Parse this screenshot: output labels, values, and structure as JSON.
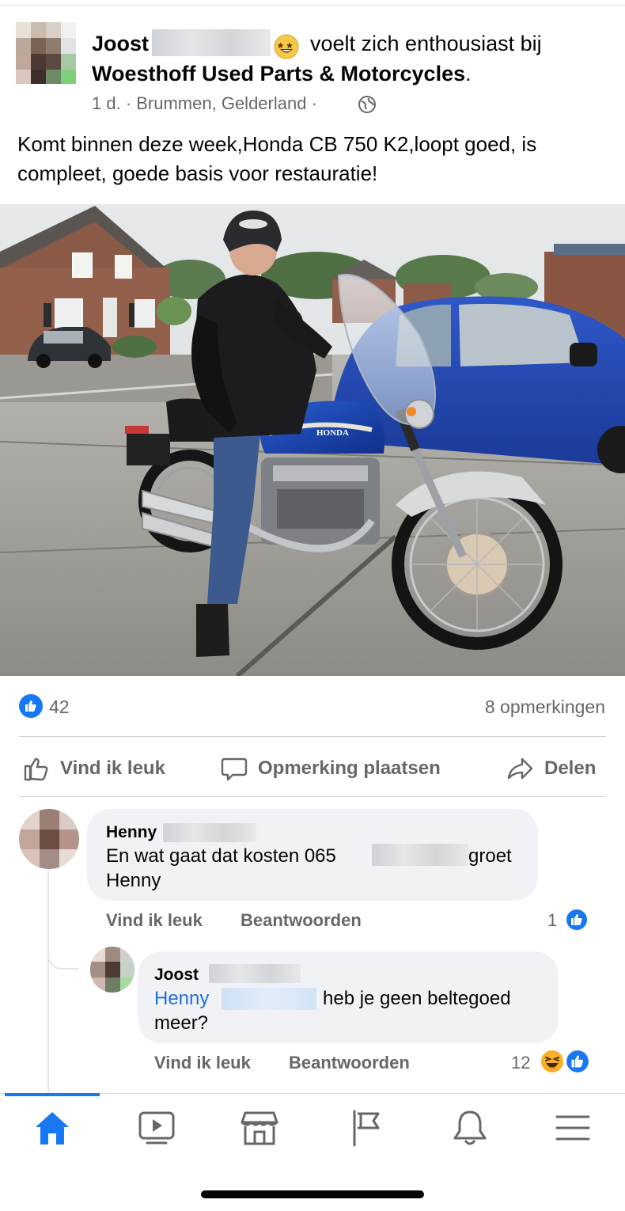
{
  "post": {
    "author": "Joost",
    "feeling": "voelt zich enthousiast bij",
    "page": "Woesthoff Used Parts & Motorcycles",
    "page_suffix": ".",
    "meta": "1 d. · Brummen, Gelderland ·",
    "text": "Komt binnen deze week,Honda CB 750 K2,loopt goed, is compleet, goede basis voor restauratie!",
    "feeling_icon": "grinning-star-eyes-emoji",
    "audience_icon": "globe-icon"
  },
  "photo": {
    "tank_brand": "HONDA"
  },
  "stats": {
    "likes": "42",
    "comments": "8 opmerkingen"
  },
  "actions": {
    "like": "Vind ik leuk",
    "comment": "Opmerking plaatsen",
    "share": "Delen"
  },
  "comments": [
    {
      "name": "Henny",
      "line1_a": "En wat gaat dat kosten 065",
      "line1_b": "groet",
      "line2": "Henny",
      "like": "Vind ik leuk",
      "reply": "Beantwoorden",
      "reactions": "1"
    },
    {
      "name": "Joost",
      "mention": "Henny",
      "line1_b": "heb je geen beltegoed",
      "line2": "meer?",
      "like": "Vind ik leuk",
      "reply": "Beantwoorden",
      "reactions": "12"
    }
  ],
  "tabs": [
    "home-icon",
    "video-icon",
    "marketplace-icon",
    "pages-flag-icon",
    "notifications-bell-icon",
    "menu-icon"
  ],
  "colors": {
    "accent": "#1877f2",
    "secondary_text": "#65676b",
    "bubble": "#f0f2f5",
    "mention": "#216fdb"
  }
}
